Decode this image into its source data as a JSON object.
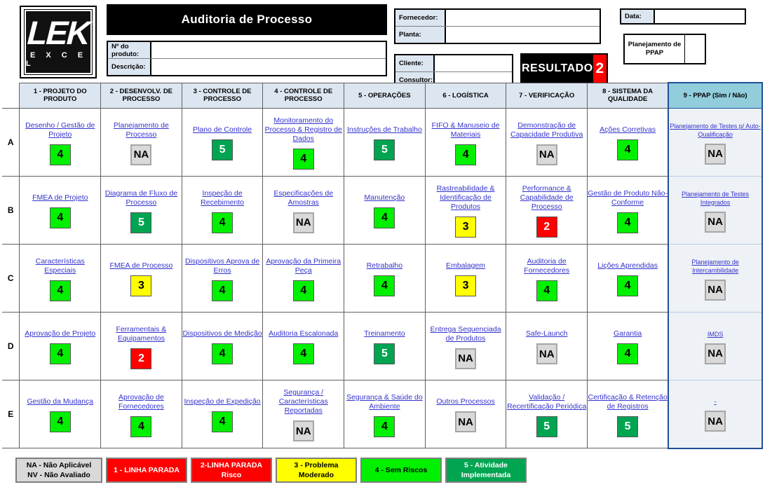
{
  "header": {
    "logo": {
      "mark": "LEK",
      "word": "E X C E L"
    },
    "title": "Auditoria de Processo",
    "fields": [
      {
        "label": "Nº do produto:",
        "value": ""
      },
      {
        "label": "Descrição:",
        "value": ""
      },
      {
        "label": "Cliente:",
        "value": ""
      },
      {
        "label": "Consultor:",
        "value": ""
      },
      {
        "label": "Fornecedor:",
        "value": ""
      },
      {
        "label": "Planta:",
        "value": ""
      },
      {
        "label": "Data:",
        "value": ""
      }
    ],
    "resultado": {
      "label": "RESULTADO",
      "score": "2",
      "color": "#ff0000"
    },
    "ppap_plan": {
      "label": "Planejamento de PPAP",
      "value": ""
    }
  },
  "columns": [
    {
      "id": "c1",
      "label": "1 - PROJETO DO PRODUTO"
    },
    {
      "id": "c2",
      "label": "2 - DESENVOLV. DE PROCESSO"
    },
    {
      "id": "c3",
      "label": "3 - CONTROLE DE PROCESSO"
    },
    {
      "id": "c4",
      "label": "4 - CONTROLE DE PROCESSO"
    },
    {
      "id": "c5",
      "label": "5 - OPERAÇÕES"
    },
    {
      "id": "c6",
      "label": "6 - LOGÍSTICA"
    },
    {
      "id": "c7",
      "label": "7 - VERIFICAÇÃO"
    },
    {
      "id": "c8",
      "label": "8 - SISTEMA DA QUALIDADE"
    },
    {
      "id": "c9",
      "label": "9 - PPAP (Sim / Não)"
    }
  ],
  "rows": [
    {
      "label": "A",
      "cells": [
        {
          "title": "Desenho / Gestão de Projeto",
          "score": "4"
        },
        {
          "title": "Planejamento de Processo",
          "score": "NA"
        },
        {
          "title": "Plano de Controle",
          "score": "5"
        },
        {
          "title": "Monitoramento do Processo & Registro de Dados",
          "score": "4"
        },
        {
          "title": "Instruções de Trabalho",
          "score": "5"
        },
        {
          "title": "FIFO & Manuseio de Materiais",
          "score": "4"
        },
        {
          "title": "Demonstração de Capacidade Produtiva",
          "score": "NA"
        },
        {
          "title": "Ações Corretivas",
          "score": "4"
        },
        {
          "title": "Planejamento de Testes p/ Auto-Qualificação",
          "score": "NA"
        }
      ]
    },
    {
      "label": "B",
      "cells": [
        {
          "title": "FMEA de Projeto",
          "score": "4"
        },
        {
          "title": "Diagrama de Fluxo de Processo",
          "score": "5"
        },
        {
          "title": "Inspeção de Recebimento",
          "score": "4"
        },
        {
          "title": "Especificações de Amostras",
          "score": "NA"
        },
        {
          "title": "Manutenção",
          "score": "4"
        },
        {
          "title": "Rastreabilidade & Identificação de Produtos",
          "score": "3"
        },
        {
          "title": "Performance & Capabilidade de Processo",
          "score": "2"
        },
        {
          "title": "Gestão de Produto Não-Conforme",
          "score": "4"
        },
        {
          "title": "Planejamento de Testes Integrados",
          "score": "NA"
        }
      ]
    },
    {
      "label": "C",
      "cells": [
        {
          "title": "Características Especiais",
          "score": "4"
        },
        {
          "title": "FMEA de Processo",
          "score": "3"
        },
        {
          "title": "Dispositivos Aprova de Erros",
          "score": "4"
        },
        {
          "title": "Aprovação da Primeira Peça",
          "score": "4"
        },
        {
          "title": "Retrabalho",
          "score": "4"
        },
        {
          "title": "Embalagem",
          "score": "3"
        },
        {
          "title": "Auditoria de Fornecedores",
          "score": "4"
        },
        {
          "title": "Lições Aprendidas",
          "score": "4"
        },
        {
          "title": "Planejamento de Intercambilidade",
          "score": "NA"
        }
      ]
    },
    {
      "label": "D",
      "cells": [
        {
          "title": "Aprovação de Projeto",
          "score": "4"
        },
        {
          "title": "Ferramentais & Equipamentos",
          "score": "2"
        },
        {
          "title": "Dispositivos de Medição",
          "score": "4"
        },
        {
          "title": "Auditoria Escalonada",
          "score": "4"
        },
        {
          "title": "Treinamento",
          "score": "5"
        },
        {
          "title": "Entrega Sequenciada de Produtos",
          "score": "NA"
        },
        {
          "title": "Safe-Launch",
          "score": "NA"
        },
        {
          "title": "Garantia",
          "score": "4"
        },
        {
          "title": "IMDS",
          "score": "NA"
        }
      ]
    },
    {
      "label": "E",
      "cells": [
        {
          "title": "Gestão da Mudança",
          "score": "4"
        },
        {
          "title": "Aprovação de Fornecedores",
          "score": "4"
        },
        {
          "title": "Inspeção de Expedição",
          "score": "4"
        },
        {
          "title": "Segurança / Características Reportadas",
          "score": "NA"
        },
        {
          "title": "Segurança & Saúde do Ambiente",
          "score": "4"
        },
        {
          "title": "Outros Processos",
          "score": "NA"
        },
        {
          "title": "Validação / Recertificação Periódica",
          "score": "5"
        },
        {
          "title": "Certificação & Retenção de Registros",
          "score": "5"
        },
        {
          "title": "-",
          "score": "NA"
        }
      ]
    }
  ],
  "legend": [
    {
      "label": "NA - Não Aplicável\nNV - Não Avaliado",
      "color": "#d9d9d9"
    },
    {
      "label": "1 - LINHA PARADA",
      "color": "#ff0000"
    },
    {
      "label": "2-LINHA PARADA Risco",
      "color": "#ff0000"
    },
    {
      "label": "3 - Problema Moderado",
      "color": "#ffff00"
    },
    {
      "label": "4 - Sem Riscos",
      "color": "#00f000"
    },
    {
      "label": "5 - Atividade Implementada",
      "color": "#00a451"
    }
  ]
}
